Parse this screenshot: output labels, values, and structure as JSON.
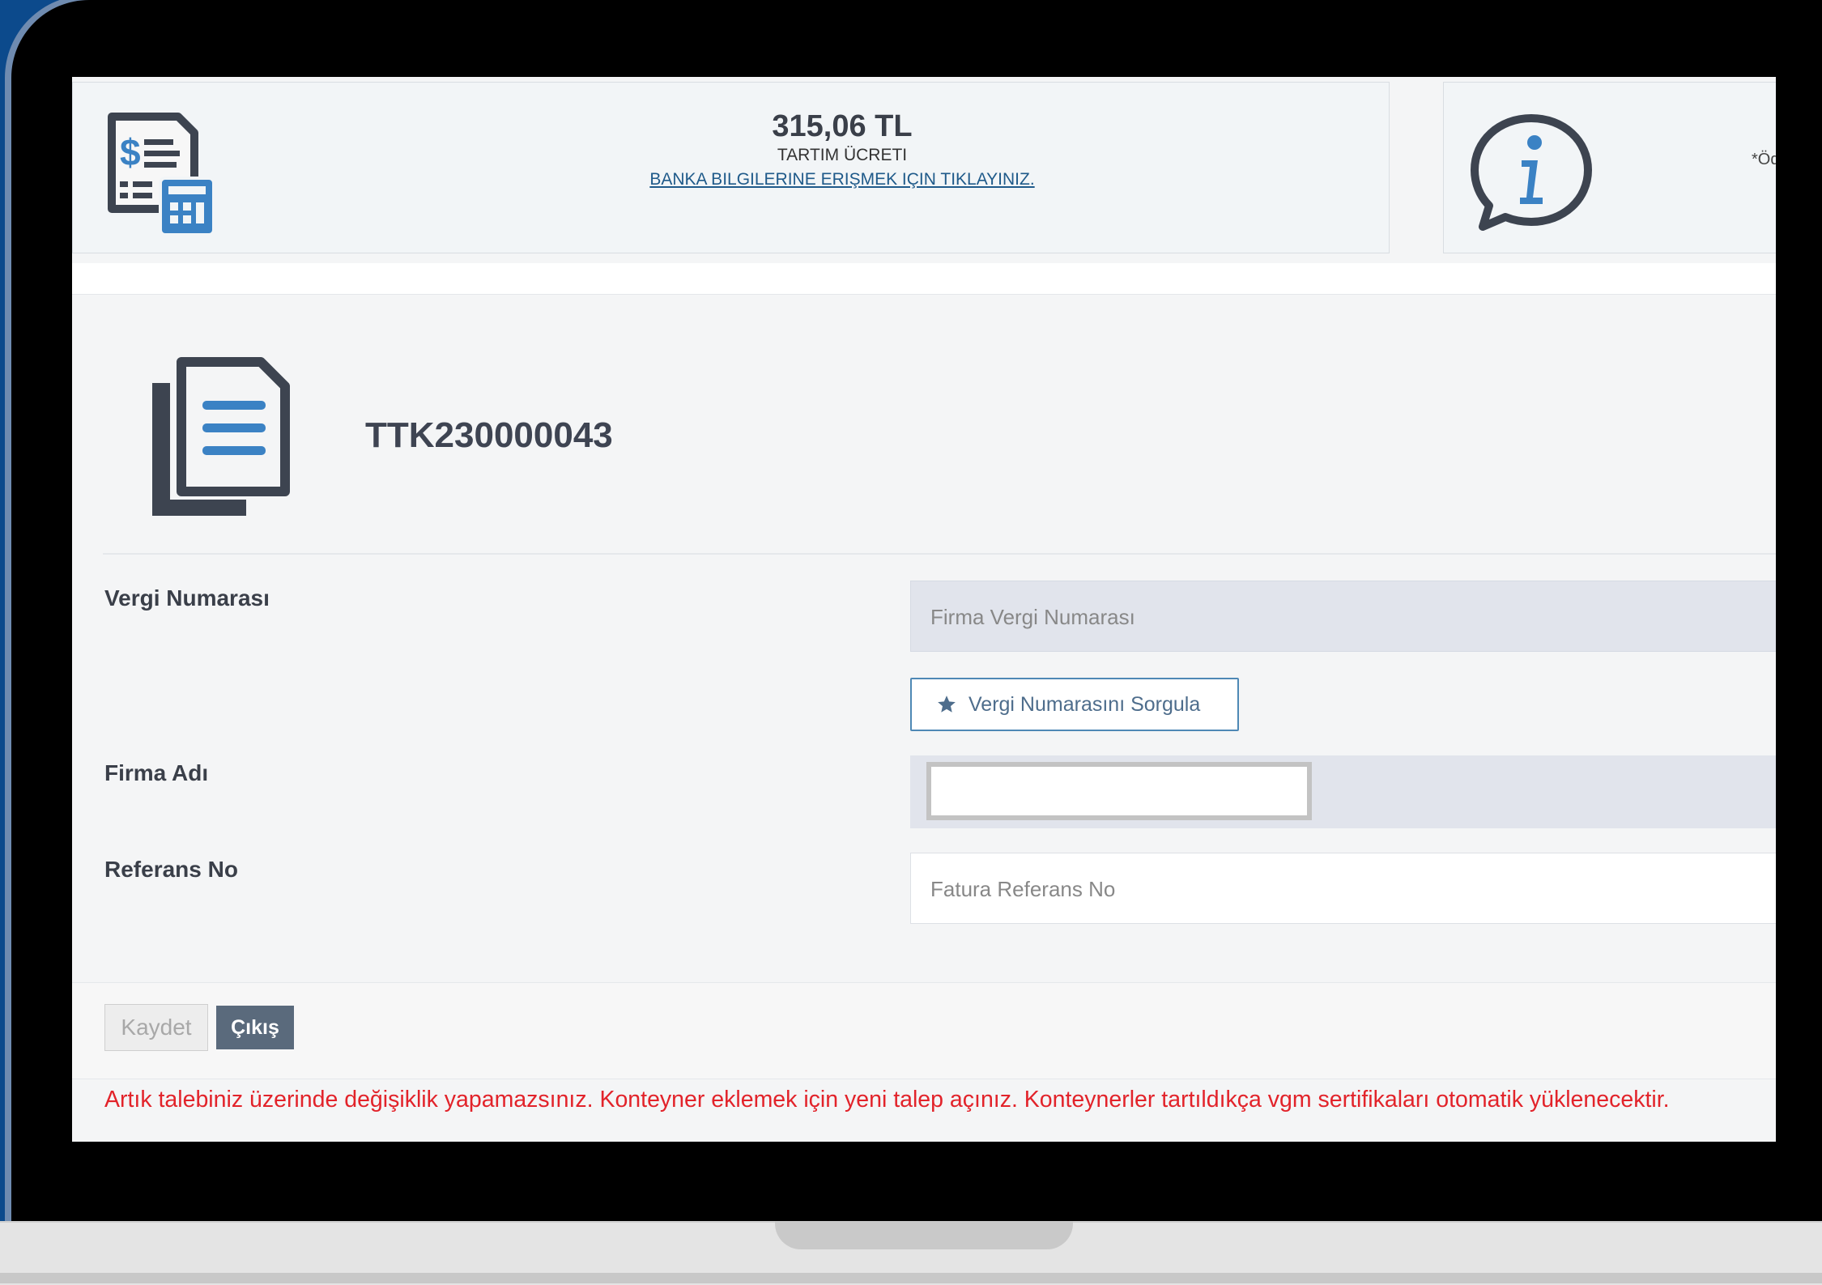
{
  "fee": {
    "amount": "315,06 TL",
    "label": "TARTIM ÜCRETI",
    "bank_link": "BANKA BILGILERINE ERIŞMEK IÇIN TIKLAYINIZ."
  },
  "info": {
    "text": "*Öd"
  },
  "request": {
    "number": "TTK230000043"
  },
  "form": {
    "tax_label": "Vergi Numarası",
    "tax_placeholder": "Firma Vergi Numarası",
    "query_button": "Vergi Numarasını Sorgula",
    "company_label": "Firma Adı",
    "company_value": "",
    "reference_label": "Referans No",
    "reference_placeholder": "Fatura Referans No"
  },
  "actions": {
    "save": "Kaydet",
    "exit": "Çıkış"
  },
  "warning": "Artık talebiniz üzerinde değişiklik yapamazsınız. Konteyner eklemek için yeni talep açınız. Konteynerler tartıldıkça vgm sertifikaları otomatik yüklenecektir.",
  "colors": {
    "accent": "#3b82c4",
    "icon_dark": "#3d4450",
    "warning": "#e2232a",
    "exit_button": "#5a6a7c"
  },
  "icons": [
    "invoice-calculator-icon",
    "info-speech-icon",
    "document-icon",
    "star-icon"
  ]
}
